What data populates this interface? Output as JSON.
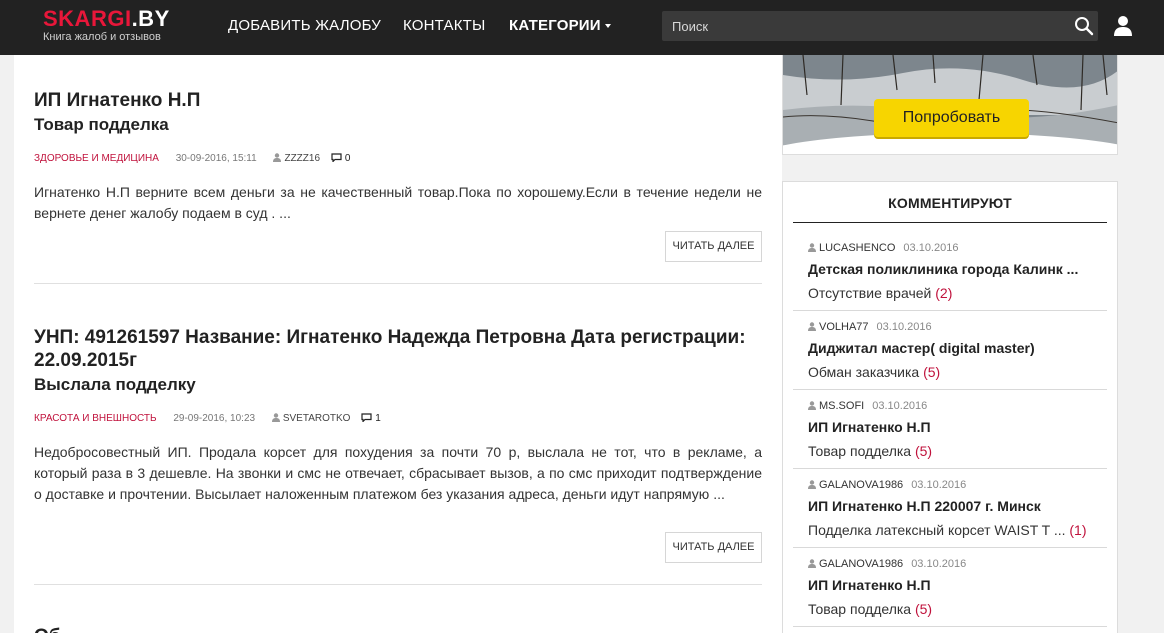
{
  "header": {
    "logo_title_main": "SKARGI",
    "logo_title_dot": ".BY",
    "logo_subtitle": "Книга жалоб и отзывов",
    "nav_add": "ДОБАВИТЬ ЖАЛОБУ",
    "nav_contacts": "КОНТАКТЫ",
    "nav_categories": "КАТЕГОРИИ",
    "search_placeholder": "Поиск",
    "search_icon": "search-icon",
    "user_icon": "user-icon"
  },
  "posts": [
    {
      "title": "ИП Игнатенко Н.П",
      "subtitle": "Товар подделка",
      "category": "Здоровье и медицина",
      "date": "30-09-2016, 15:11",
      "author": "ZZZZ16",
      "comments": "0",
      "excerpt": "Игнатенко Н.П верните всем деньги за не качественный товар.Пока по хорошему.Если в течение недели не вернете денег жалобу подаем в суд . ...",
      "read_more": "Читать далее"
    },
    {
      "title": "УНП: 491261597 Название: Игнатенко Надежда Петровна Дата регистрации: 22.09.2015г",
      "subtitle": "Выслала подделку",
      "category": "Красота и внешность",
      "date": "29-09-2016, 10:23",
      "author": "SVETAROTKO",
      "comments": "1",
      "excerpt": "Недобросовестный ИП. Продала корсет для похудения за почти 70 р, выслала не тот, что в рекламе, а который раза в 3 дешевле. На звонки и смс не отвечает, сбрасывает вызов, а по смс приходит подтверждение о доставке и прочтении. Высылает наложенным платежом без указания адреса, деньги идут напрямую ...",
      "read_more": "Читать далее"
    },
    {
      "title": "Об",
      "subtitle": ""
    }
  ],
  "ad": {
    "button_label": "Попробовать"
  },
  "sidebar": {
    "title": "КОММЕНТИРУЮТ",
    "items": [
      {
        "user": "LUCASHENCO",
        "date": "03.10.2016",
        "title": "Детская поликлиника города Калинк ...",
        "subtitle": "Отсутствие врачей",
        "count": "(2)"
      },
      {
        "user": "VOLHA77",
        "date": "03.10.2016",
        "title": "Диджитал мастер( digital master)",
        "subtitle": "Обман заказчика",
        "count": "(5)"
      },
      {
        "user": "MS.SOFI",
        "date": "03.10.2016",
        "title": "ИП Игнатенко Н.П",
        "subtitle": "Товар подделка",
        "count": "(5)"
      },
      {
        "user": "GALANOVA1986",
        "date": "03.10.2016",
        "title": "ИП Игнатенко Н.П 220007 г. Минск",
        "subtitle": "Подделка латексный корсет WAIST T ...",
        "count": "(1)"
      },
      {
        "user": "GALANOVA1986",
        "date": "03.10.2016",
        "title": "ИП Игнатенко Н.П",
        "subtitle": "Товар подделка",
        "count": "(5)"
      }
    ]
  },
  "colors": {
    "header_bg": "#222222",
    "accent": "#c0123c",
    "logo_red": "#e8173a",
    "ad_button": "#f7d500"
  }
}
